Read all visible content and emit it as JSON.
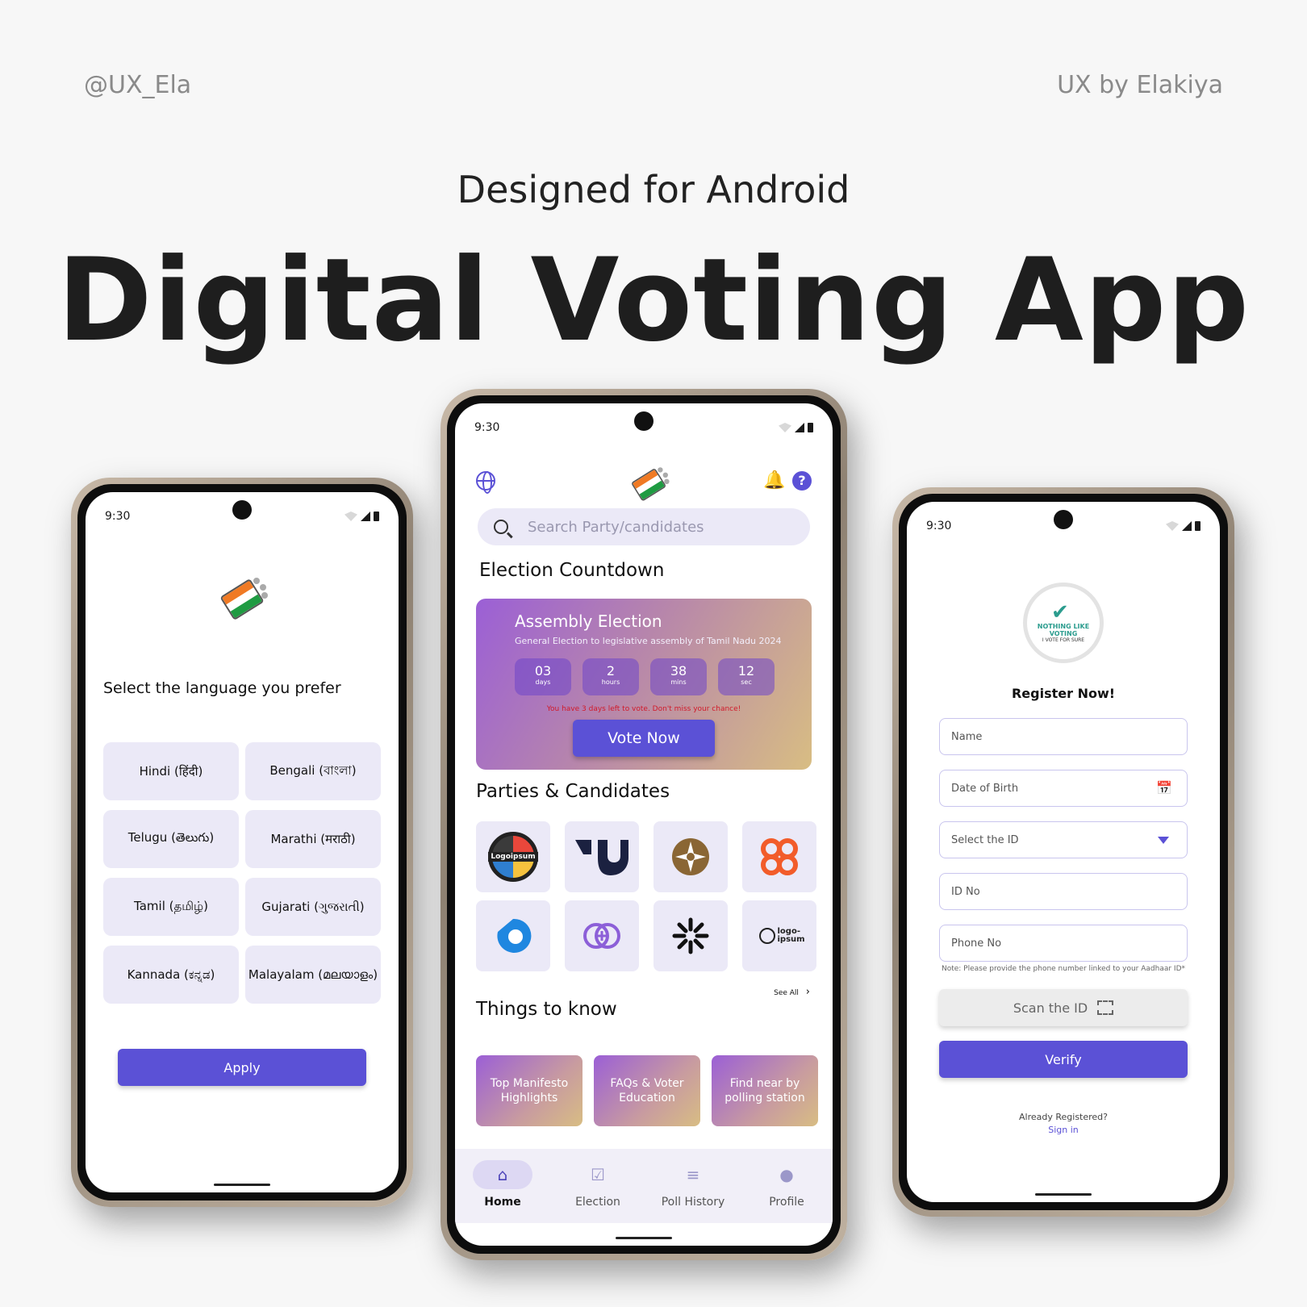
{
  "header": {
    "handle": "@UX_Ela",
    "credit": "UX by Elakiya",
    "subtitle": "Designed for Android",
    "title": "Digital Voting App"
  },
  "status": {
    "time": "9:30"
  },
  "language_screen": {
    "heading": "Select the language you prefer",
    "languages": [
      "Hindi (हिंदी)",
      "Bengali (বাংলা)",
      "Telugu (తెలుగు)",
      "Marathi (मराठी)",
      "Tamil (தமிழ்)",
      "Gujarati (ગુજરાતી)",
      "Kannada (ಕನ್ನಡ)",
      "Malayalam (മലയാളം)"
    ],
    "apply_label": "Apply"
  },
  "home_screen": {
    "search_placeholder": "Search Party/candidates",
    "countdown_heading": "Election Countdown",
    "election": {
      "title": "Assembly Election",
      "subtitle": "General Election to legislative assembly of Tamil Nadu 2024",
      "countdown": [
        {
          "value": "03",
          "unit": "days"
        },
        {
          "value": "2",
          "unit": "hours"
        },
        {
          "value": "38",
          "unit": "mins"
        },
        {
          "value": "12",
          "unit": "sec"
        }
      ],
      "warning": "You have 3 days left to vote. Don't miss your chance!",
      "vote_label": "Vote Now"
    },
    "parties_heading": "Parties & Candidates",
    "party_logos": [
      "Logoipsum",
      "logo-ipsum"
    ],
    "see_all": "See All",
    "know_heading": "Things to know",
    "know_cards": [
      "Top Manifesto Highlights",
      "FAQs & Voter Education",
      "Find near by polling station"
    ],
    "nav": [
      "Home",
      "Election",
      "Poll History",
      "Profile"
    ]
  },
  "register_screen": {
    "logo_text_1": "NOTHING LIKE",
    "logo_text_2": "VOTING",
    "logo_text_3": "I VOTE FOR SURE",
    "heading": "Register Now!",
    "fields": {
      "name": "Name",
      "dob": "Date of Birth",
      "id_select": "Select the ID",
      "id_no": "ID No",
      "phone": "Phone No"
    },
    "note": "Note: Please provide the phone number linked to your Aadhaar ID*",
    "scan_label": "Scan the ID",
    "verify_label": "Verify",
    "already": "Already Registered?",
    "signin": "Sign in"
  },
  "colors": {
    "primary": "#5b51d6",
    "tile": "#ebe9f7",
    "warning": "#d11a2a"
  }
}
